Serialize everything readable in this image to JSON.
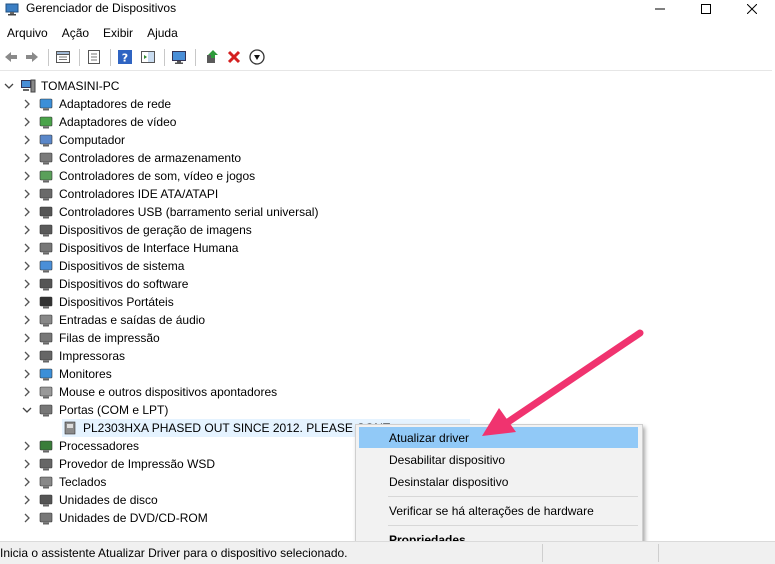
{
  "window": {
    "title": "Gerenciador de Dispositivos",
    "minimize_icon": "minimize-icon",
    "maximize_icon": "maximize-icon",
    "close_icon": "close-icon"
  },
  "menu": [
    "Arquivo",
    "Ação",
    "Exibir",
    "Ajuda"
  ],
  "toolbar": [
    "back-arrow-icon",
    "forward-arrow-icon",
    "properties-sheet-icon",
    "device-list-icon",
    "help-icon",
    "action-pane-icon",
    "monitor-icon",
    "update-driver-icon",
    "uninstall-x-icon",
    "download-circle-icon"
  ],
  "tree": {
    "root": "TOMASINI-PC",
    "categories": [
      {
        "label": "Adaptadores de rede",
        "icon": "network-adapter-icon"
      },
      {
        "label": "Adaptadores de vídeo",
        "icon": "display-adapter-icon"
      },
      {
        "label": "Computador",
        "icon": "computer-icon"
      },
      {
        "label": "Controladores de armazenamento",
        "icon": "storage-controller-icon"
      },
      {
        "label": "Controladores de som, vídeo e jogos",
        "icon": "sound-icon"
      },
      {
        "label": "Controladores IDE ATA/ATAPI",
        "icon": "ide-icon"
      },
      {
        "label": "Controladores USB (barramento serial universal)",
        "icon": "usb-icon"
      },
      {
        "label": "Dispositivos de geração de imagens",
        "icon": "camera-icon"
      },
      {
        "label": "Dispositivos de Interface Humana",
        "icon": "hid-icon"
      },
      {
        "label": "Dispositivos de sistema",
        "icon": "system-device-icon"
      },
      {
        "label": "Dispositivos do software",
        "icon": "software-device-icon"
      },
      {
        "label": "Dispositivos Portáteis",
        "icon": "portable-device-icon"
      },
      {
        "label": "Entradas e saídas de áudio",
        "icon": "speaker-icon"
      },
      {
        "label": "Filas de impressão",
        "icon": "print-queue-icon"
      },
      {
        "label": "Impressoras",
        "icon": "printer-icon"
      },
      {
        "label": "Monitores",
        "icon": "monitor-icon"
      },
      {
        "label": "Mouse e outros dispositivos apontadores",
        "icon": "mouse-icon"
      },
      {
        "label": "Portas (COM e LPT)",
        "icon": "port-icon"
      }
    ],
    "port_child": "PL2303HXA PHASED OUT SINCE 2012. PLEASE CONT",
    "after": [
      {
        "label": "Processadores",
        "icon": "processor-icon"
      },
      {
        "label": "Provedor de Impressão WSD",
        "icon": "wsd-printer-icon"
      },
      {
        "label": "Teclados",
        "icon": "keyboard-icon"
      },
      {
        "label": "Unidades de disco",
        "icon": "disk-drive-icon"
      },
      {
        "label": "Unidades de DVD/CD-ROM",
        "icon": "dvd-drive-icon"
      }
    ]
  },
  "context_menu": {
    "update": "Atualizar driver",
    "disable": "Desabilitar dispositivo",
    "uninstall": "Desinstalar dispositivo",
    "scan": "Verificar se há alterações de hardware",
    "properties": "Propriedades"
  },
  "status": "Inicia o assistente Atualizar Driver para o dispositivo selecionado.",
  "colors": {
    "highlight": "#91c9f7",
    "selection": "#e5f3ff",
    "arrow": "#f0336f"
  }
}
